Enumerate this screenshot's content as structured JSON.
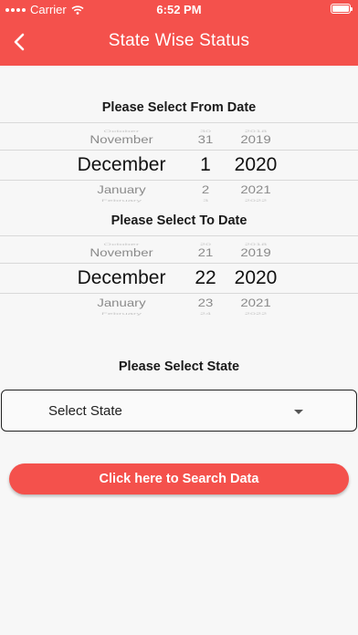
{
  "status_bar": {
    "carrier": "Carrier",
    "time": "6:52 PM"
  },
  "header": {
    "title": "State Wise Status",
    "back_icon": "chevron-left-icon"
  },
  "from_date": {
    "label": "Please Select From Date",
    "rows": [
      {
        "month": "October",
        "day": "30",
        "year": "2018"
      },
      {
        "month": "November",
        "day": "31",
        "year": "2019"
      },
      {
        "month": "December",
        "day": "1",
        "year": "2020"
      },
      {
        "month": "January",
        "day": "2",
        "year": "2021"
      },
      {
        "month": "February",
        "day": "3",
        "year": "2022"
      }
    ]
  },
  "to_date": {
    "label": "Please Select To Date",
    "rows": [
      {
        "month": "October",
        "day": "20",
        "year": "2018"
      },
      {
        "month": "November",
        "day": "21",
        "year": "2019"
      },
      {
        "month": "December",
        "day": "22",
        "year": "2020"
      },
      {
        "month": "January",
        "day": "23",
        "year": "2021"
      },
      {
        "month": "February",
        "day": "24",
        "year": "2022"
      }
    ]
  },
  "state": {
    "label": "Please Select State",
    "selected": "Select State"
  },
  "search_button": {
    "label": "Click here to Search Data"
  },
  "colors": {
    "accent": "#f4514c",
    "background": "#f7f7f7"
  }
}
